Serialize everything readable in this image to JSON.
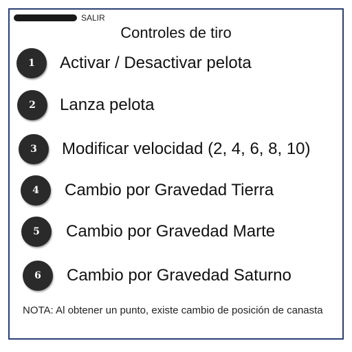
{
  "header": {
    "back_label": "SALIR"
  },
  "title": "Controles de tiro",
  "controls": [
    {
      "number": "1",
      "label": "Activar / Desactivar pelota"
    },
    {
      "number": "2",
      "label": "Lanza pelota"
    },
    {
      "number": "3",
      "label": "Modificar velocidad (2, 4, 6, 8, 10)"
    },
    {
      "number": "4",
      "label": "Cambio por Gravedad Tierra"
    },
    {
      "number": "5",
      "label": "Cambio por Gravedad Marte"
    },
    {
      "number": "6",
      "label": "Cambio por Gravedad Saturno"
    }
  ],
  "note": "NOTA: Al obtener un punto, existe cambio de posición de canasta",
  "colors": {
    "border": "#2c3e73",
    "badge": "#2a2a2a",
    "back_bar": "#1a1a1a"
  }
}
